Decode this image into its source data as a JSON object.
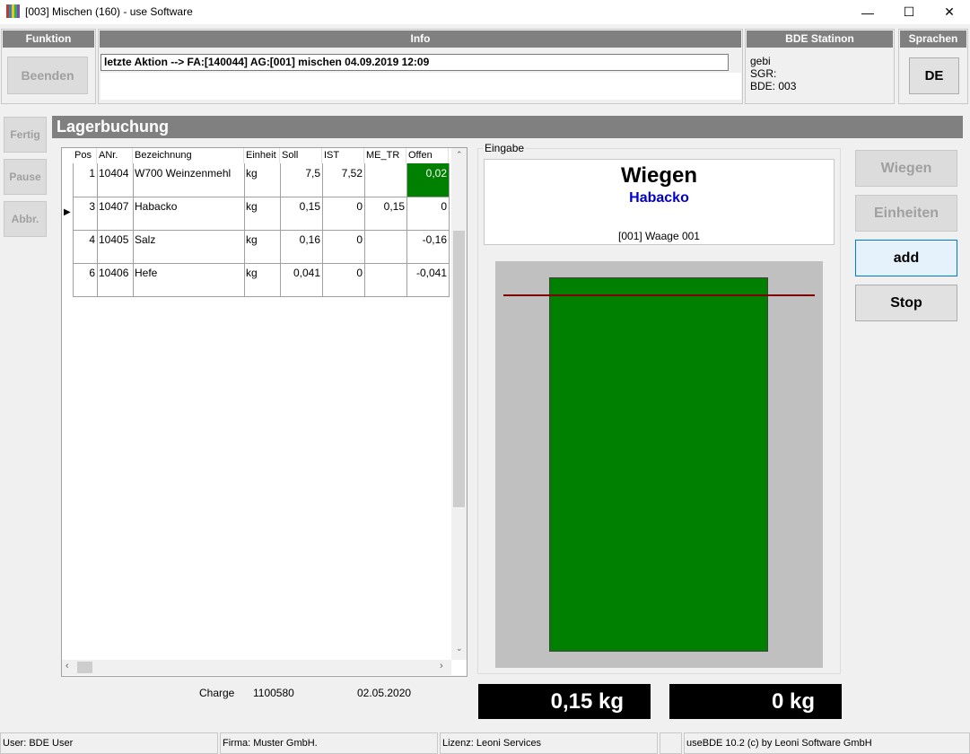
{
  "window": {
    "title": "[003] Mischen (160) - use Software",
    "icon": "app-grid-icon",
    "controls": [
      "minimize-icon",
      "maximize-icon",
      "close-icon"
    ]
  },
  "funktion": {
    "header": "Funktion",
    "beenden": "Beenden"
  },
  "info": {
    "header": "Info",
    "message": "letzte Aktion --> FA:[140044] AG:[001] mischen 04.09.2019 12:09"
  },
  "station": {
    "header": "BDE Statinon",
    "lines": [
      "gebi",
      "SGR:",
      "BDE: 003"
    ]
  },
  "sprachen": {
    "header": "Sprachen",
    "lang": "DE"
  },
  "side_buttons": {
    "fertig": "Fertig",
    "pause": "Pause",
    "abbr": "Abbr."
  },
  "section_title": "Lagerbuchung",
  "table": {
    "columns": [
      "Pos",
      "ANr.",
      "Bezeichnung",
      "Einheit",
      "Soll",
      "IST",
      "ME_TR",
      "Offen"
    ],
    "rows": [
      {
        "pos": "1",
        "anr": "10404",
        "bez": "W700 Weinzenmehl",
        "einheit": "kg",
        "soll": "7,5",
        "ist": "7,52",
        "metr": "",
        "offen": "0,02"
      },
      {
        "pos": "3",
        "anr": "10407",
        "bez": "Habacko",
        "einheit": "kg",
        "soll": "0,15",
        "ist": "0",
        "metr": "0,15",
        "offen": "0"
      },
      {
        "pos": "4",
        "anr": "10405",
        "bez": "Salz",
        "einheit": "kg",
        "soll": "0,16",
        "ist": "0",
        "metr": "",
        "offen": "-0,16"
      },
      {
        "pos": "6",
        "anr": "10406",
        "bez": "Hefe",
        "einheit": "kg",
        "soll": "0,041",
        "ist": "0",
        "metr": "",
        "offen": "-0,041"
      }
    ],
    "selected_row": 1,
    "highlight_color": "#008000"
  },
  "footer_info": {
    "charge_label": "Charge",
    "charge_value": "1100580",
    "date": "02.05.2020"
  },
  "eingabe": {
    "label": "Eingabe",
    "title": "Wiegen",
    "item": "Habacko",
    "scale": "[001] Waage 001",
    "fill_fraction": 1.0,
    "bar_color": "#008000",
    "target_line_color": "#800000"
  },
  "readouts": {
    "left": "0,15 kg",
    "right": "0 kg"
  },
  "right_buttons": {
    "wiegen": "Wiegen",
    "einheiten": "Einheiten",
    "add": "add",
    "stop": "Stop"
  },
  "statusbar": {
    "user": "User: BDE User",
    "firma": "Firma: Muster GmbH.",
    "lizenz": "Lizenz: Leoni Services",
    "version": "useBDE 10.2 (c) by Leoni Software GmbH"
  }
}
